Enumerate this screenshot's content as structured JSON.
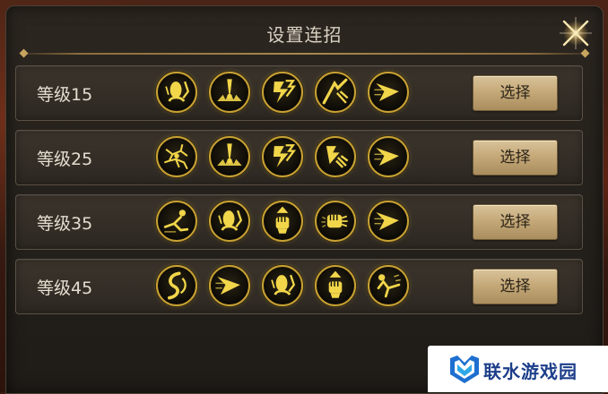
{
  "dialog": {
    "title": "设置连招",
    "close_icon": "close-x-icon"
  },
  "rows": [
    {
      "label": "等级15",
      "button": "选择",
      "skills": [
        "dodge-figure-icon",
        "ground-burst-icon",
        "lightning-strike-icon",
        "uppercut-slash-icon",
        "dash-arrow-icon"
      ]
    },
    {
      "label": "等级25",
      "button": "选择",
      "skills": [
        "crack-shatter-icon",
        "ground-burst-icon",
        "lightning-strike-icon",
        "hammer-strike-icon",
        "dash-arrow-icon"
      ]
    },
    {
      "label": "等级35",
      "button": "选择",
      "skills": [
        "sliding-kick-icon",
        "dodge-figure-icon",
        "rising-fist-icon",
        "fist-punch-icon",
        "dash-arrow-icon"
      ]
    },
    {
      "label": "等级45",
      "button": "选择",
      "skills": [
        "whirl-kick-icon",
        "dash-arrow-icon",
        "dodge-figure-icon",
        "rising-fist-icon",
        "flying-kick-icon"
      ]
    }
  ],
  "watermark": {
    "text": "联水游戏园",
    "logo_icon": "m-shield-logo-icon"
  },
  "colors": {
    "panel_bg": "#24201b",
    "row_bg": "#3b342c",
    "skill_gold": "#f2d64a",
    "skill_ring": "#c9a234",
    "button_bg": "#c5a979",
    "title_text": "#d8d0c2",
    "watermark_text": "#1d3f8a"
  }
}
